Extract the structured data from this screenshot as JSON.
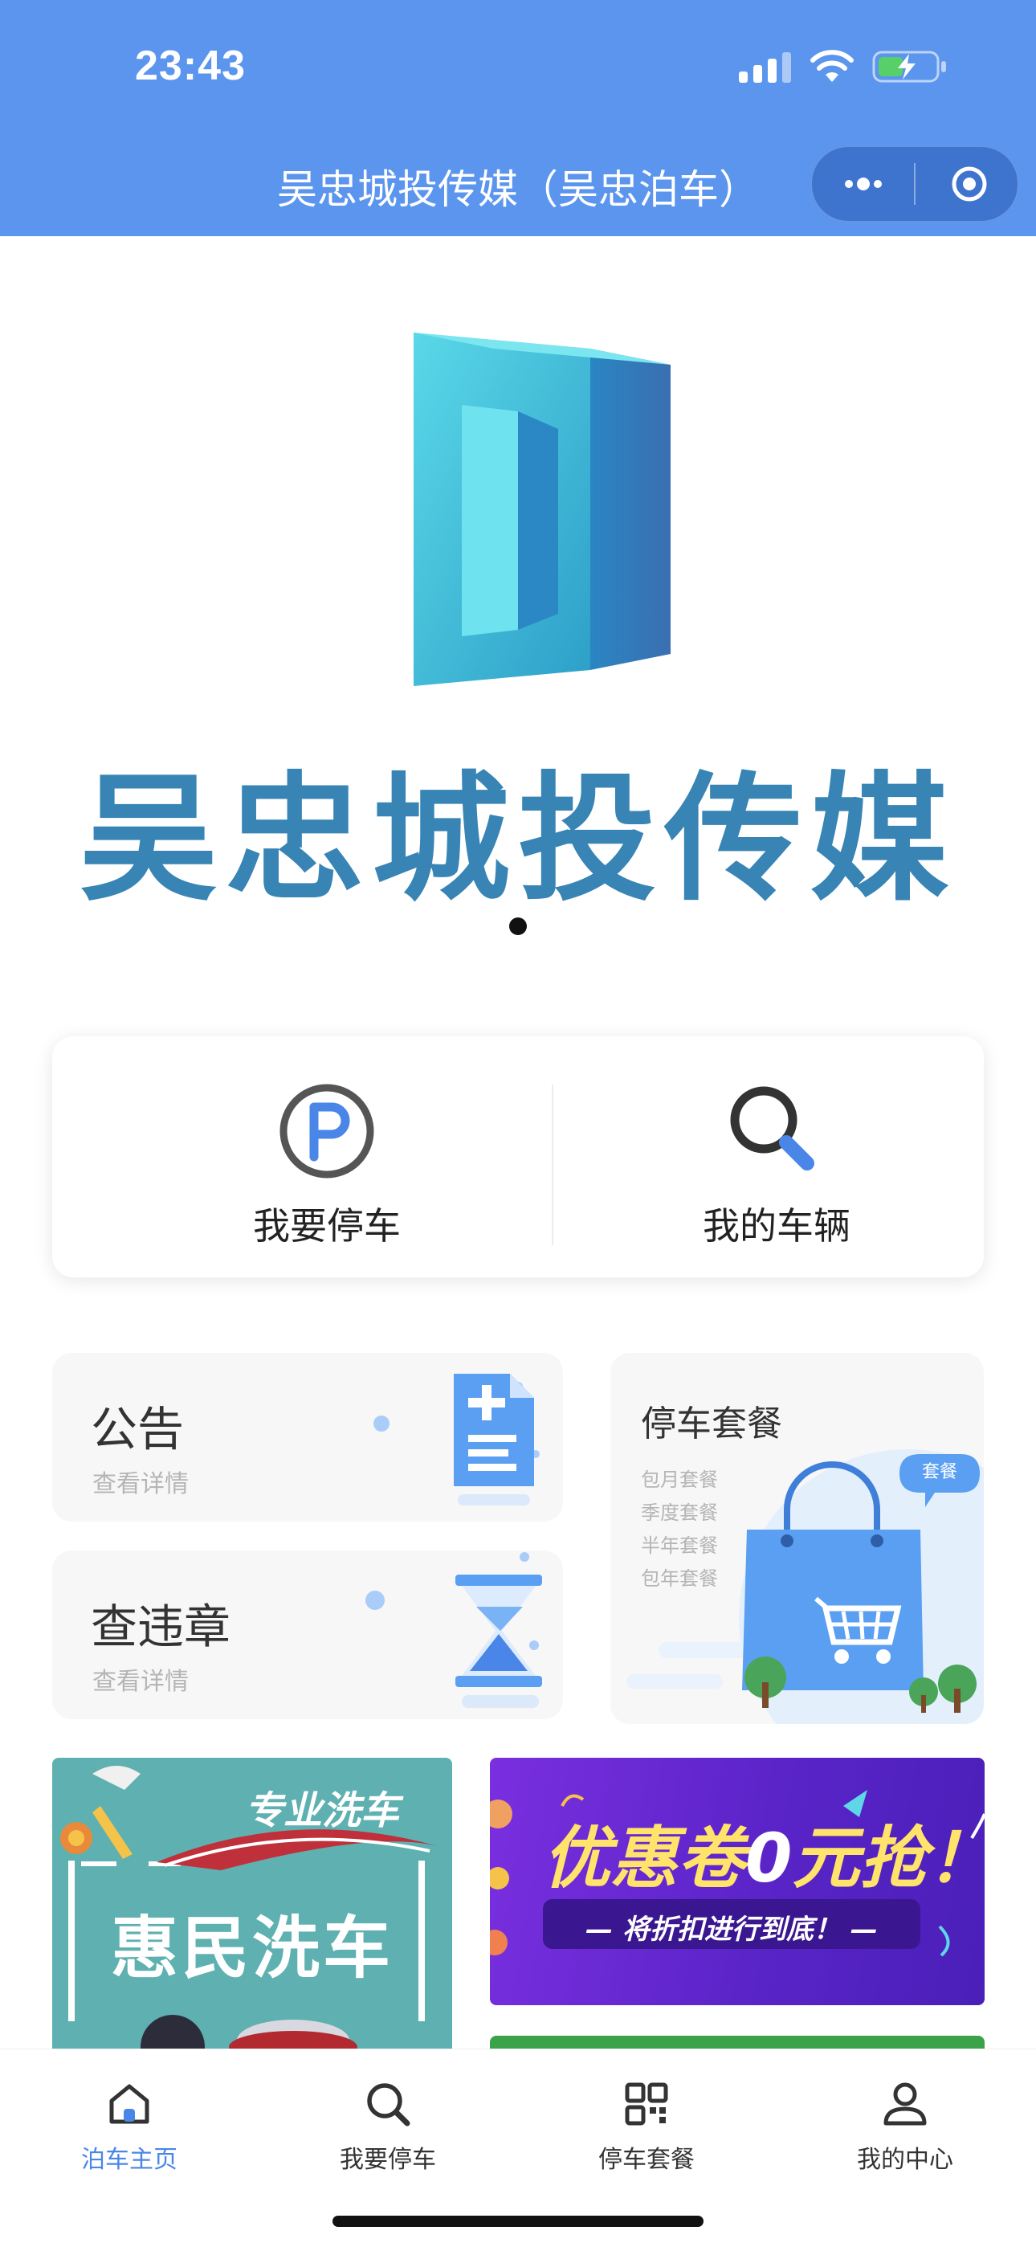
{
  "status_bar": {
    "time": "23:43"
  },
  "nav": {
    "title": "吴忠城投传媒（吴忠泊车）",
    "more_icon": "more-dots-icon",
    "close_icon": "target-icon"
  },
  "banner": {
    "title": "吴忠城投传媒",
    "logo_icon": "3d-d-logo-icon",
    "page_count": 1,
    "active_page": 1
  },
  "quick_actions": [
    {
      "label": "我要停车",
      "icon": "parking-p-icon"
    },
    {
      "label": "我的车辆",
      "icon": "magnifier-icon"
    }
  ],
  "tiles": {
    "notice": {
      "title": "公告",
      "sub": "查看详情",
      "icon": "document-plus-icon"
    },
    "violation": {
      "title": "查违章",
      "sub": "查看详情",
      "icon": "hourglass-icon"
    },
    "package": {
      "title": "停车套餐",
      "items": [
        "包月套餐",
        "季度套餐",
        "半年套餐",
        "包年套餐"
      ],
      "badge": "套餐",
      "icon": "shopping-bag-icon"
    }
  },
  "promos": {
    "carwash": {
      "tag": "专业洗车",
      "title": "惠民洗车"
    },
    "coupon": {
      "title_a": "优惠卷",
      "title_b": "0",
      "title_c": "元抢！",
      "subtitle": "— 将折扣进行到底！ —"
    }
  },
  "tabbar": [
    {
      "label": "泊车主页",
      "icon": "home-icon",
      "active": true
    },
    {
      "label": "我要停车",
      "icon": "search-icon",
      "active": false
    },
    {
      "label": "停车套餐",
      "icon": "grid-icon",
      "active": false
    },
    {
      "label": "我的中心",
      "icon": "user-icon",
      "active": false
    }
  ],
  "colors": {
    "brand": "#5b95ee",
    "tab_active": "#4a86e8",
    "logo_text": "#3784b5"
  }
}
